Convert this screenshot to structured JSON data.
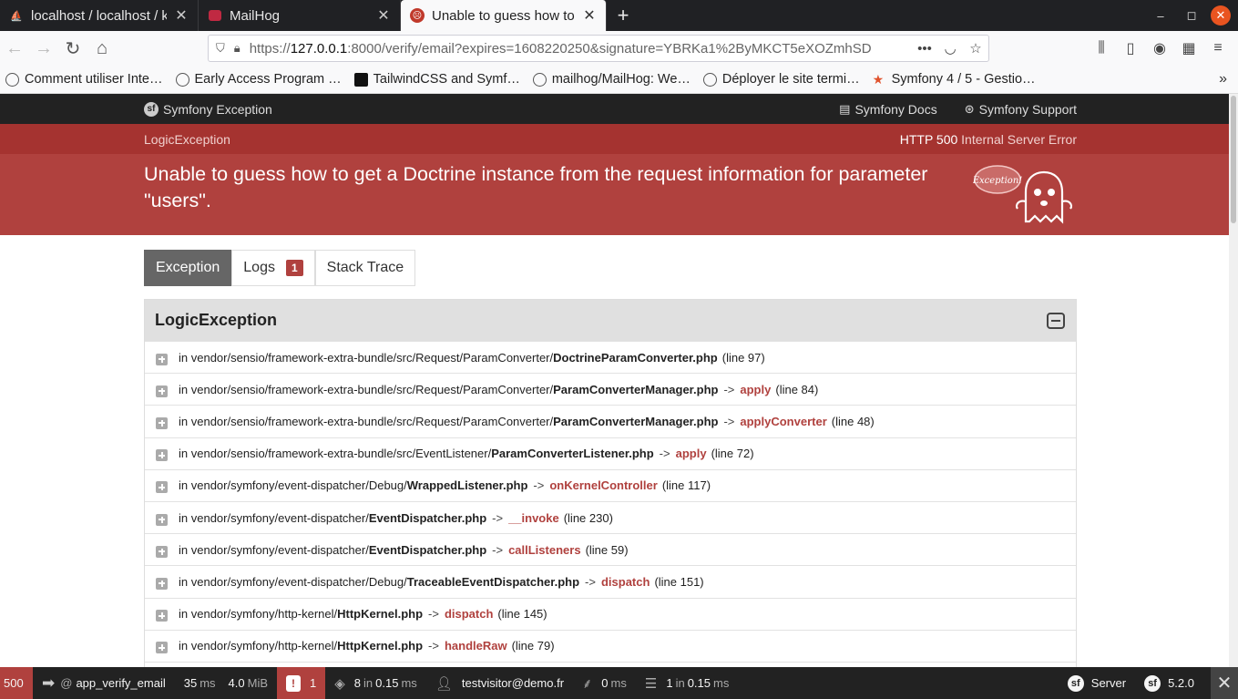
{
  "browser": {
    "tabs": [
      {
        "title": "localhost / localhost / klaxo",
        "icon": "phpmyadmin-icon"
      },
      {
        "title": "MailHog",
        "icon": "mailhog-icon"
      },
      {
        "title": "Unable to guess how to get",
        "icon": "symfony-exception-icon",
        "active": true
      }
    ],
    "url_prefix": "https://",
    "url_host": "127.0.0.1",
    "url_rest": ":8000/verify/email?expires=1608220250&signature=YBRKa1%2ByMKCT5eXOZmhSD",
    "bookmarks": [
      "Comment utiliser Inte…",
      "Early Access Program …",
      "TailwindCSS and Symf…",
      "mailhog/MailHog: We…",
      "Déployer le site termi…",
      "Symfony 4 / 5 - Gestio…"
    ]
  },
  "header": {
    "brand": "Symfony Exception",
    "docs_link": "Symfony Docs",
    "support_link": "Symfony Support"
  },
  "exception": {
    "class": "LogicException",
    "status_code": "HTTP 500",
    "status_text": "Internal Server Error",
    "message": "Unable to guess how to get a Doctrine instance from the request information for parameter \"users\".",
    "ghost_label": "Exception!"
  },
  "tabs": {
    "exception": "Exception",
    "logs": "Logs",
    "logs_count": "1",
    "stack_trace": "Stack Trace"
  },
  "trace": {
    "title": "LogicException",
    "frames": [
      {
        "prefix": "in vendor/sensio/framework-extra-bundle/src/Request/ParamConverter/",
        "file": "DoctrineParamConverter.php",
        "fn": "",
        "line": "(line 97)"
      },
      {
        "prefix": "in vendor/sensio/framework-extra-bundle/src/Request/ParamConverter/",
        "file": "ParamConverterManager.php",
        "fn": "apply",
        "line": "(line 84)"
      },
      {
        "prefix": "in vendor/sensio/framework-extra-bundle/src/Request/ParamConverter/",
        "file": "ParamConverterManager.php",
        "fn": "applyConverter",
        "line": "(line 48)"
      },
      {
        "prefix": "in vendor/sensio/framework-extra-bundle/src/EventListener/",
        "file": "ParamConverterListener.php",
        "fn": "apply",
        "line": "(line 72)"
      },
      {
        "prefix": "in vendor/symfony/event-dispatcher/Debug/",
        "file": "WrappedListener.php",
        "fn": "onKernelController",
        "line": "(line 117)"
      },
      {
        "prefix": "in vendor/symfony/event-dispatcher/",
        "file": "EventDispatcher.php",
        "fn": "__invoke",
        "line": "(line 230)"
      },
      {
        "prefix": "in vendor/symfony/event-dispatcher/",
        "file": "EventDispatcher.php",
        "fn": "callListeners",
        "line": "(line 59)"
      },
      {
        "prefix": "in vendor/symfony/event-dispatcher/Debug/",
        "file": "TraceableEventDispatcher.php",
        "fn": "dispatch",
        "line": "(line 151)"
      },
      {
        "prefix": "in vendor/symfony/http-kernel/",
        "file": "HttpKernel.php",
        "fn": "dispatch",
        "line": "(line 145)"
      },
      {
        "prefix": "in vendor/symfony/http-kernel/",
        "file": "HttpKernel.php",
        "fn": "handleRaw",
        "line": "(line 79)"
      },
      {
        "prefix": "",
        "file": "",
        "fn": "",
        "line": ""
      }
    ]
  },
  "toolbar": {
    "status": "500",
    "route_at": "@",
    "route": "app_verify_email",
    "time": "35",
    "time_unit": "ms",
    "memory": "4.0",
    "memory_unit": "MiB",
    "errors": "1",
    "events_count": "8",
    "events_in": "in",
    "events_time": "0.15",
    "events_unit": "ms",
    "user": "testvisitor@demo.fr",
    "twig_time": "0",
    "twig_unit": "ms",
    "db_count": "1",
    "db_in": "in",
    "db_time": "0.15",
    "db_unit": "ms",
    "server": "Server",
    "version": "5.2.0"
  },
  "colors": {
    "exception_red": "#b0413e",
    "band_red": "#a53330",
    "header_dark": "#222222"
  }
}
